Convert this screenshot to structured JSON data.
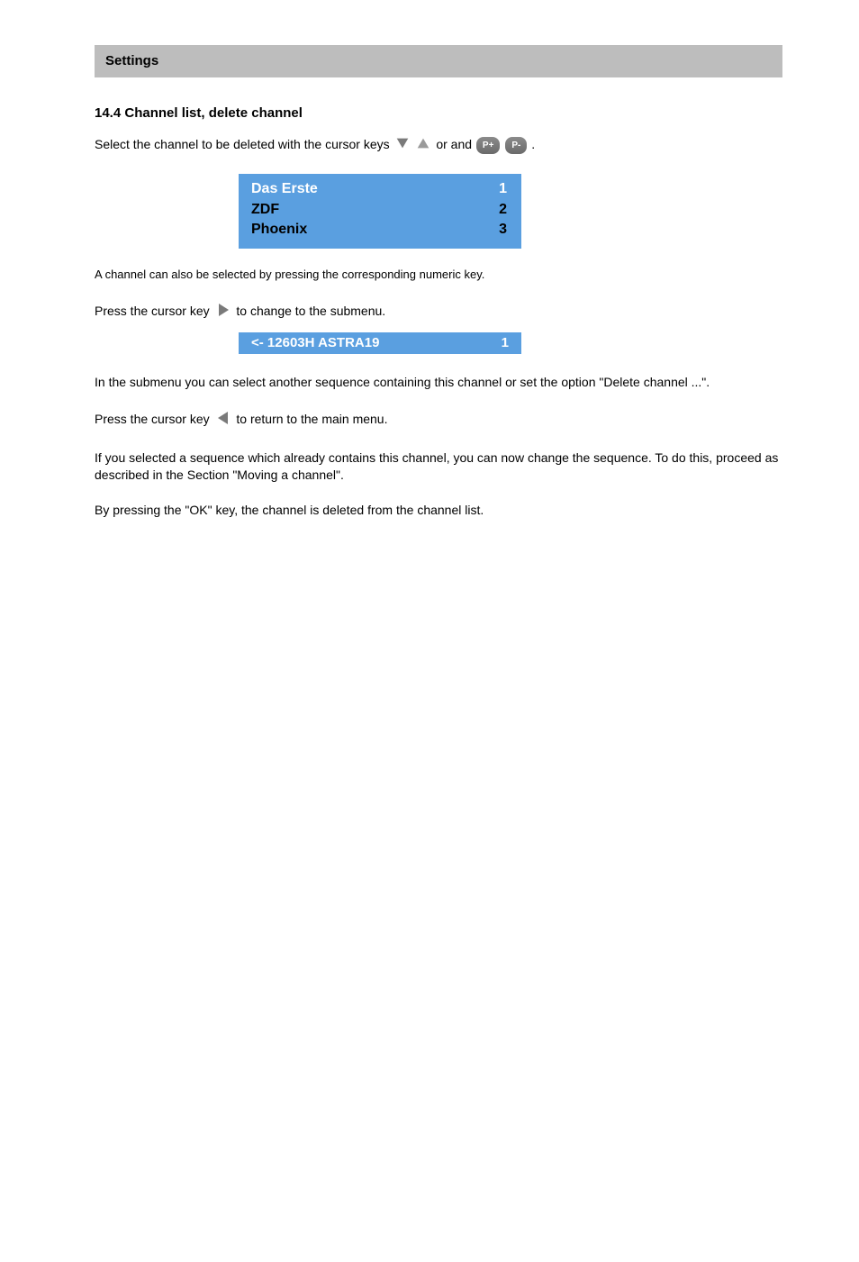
{
  "header_label": "Settings",
  "s1": {
    "title": "14.4 Channel list, delete channel",
    "p1a": "Select the channel to be deleted with the cursor keys",
    "p1b": "or",
    "p1c": "and",
    "p1d": ".",
    "channels": [
      {
        "name": "Das Erste",
        "num": "1",
        "selected": true
      },
      {
        "name": "ZDF",
        "num": "2",
        "selected": false
      },
      {
        "name": "Phoenix",
        "num": "3",
        "selected": false
      }
    ],
    "p2": "A channel can also be selected by pressing the corresponding numeric key.",
    "p3a": "Press the cursor key",
    "p3b": "to change to the submenu.",
    "submenu": {
      "label": "<- 12603H ASTRA19",
      "num": "1"
    },
    "p4": "In the submenu you can select another sequence containing this channel or set the option \"Delete channel ...\".",
    "p5a": "Press the cursor key",
    "p5b": "to return to the main menu.",
    "p6": "If you selected a sequence which already contains this channel, you can now change the sequence. To do this, proceed as described in the Section \"Moving a channel\".",
    "p7": "By pressing the \"OK\" key, the channel is deleted from the channel list."
  },
  "btnPlus": "P+",
  "btnMinus": "P-"
}
